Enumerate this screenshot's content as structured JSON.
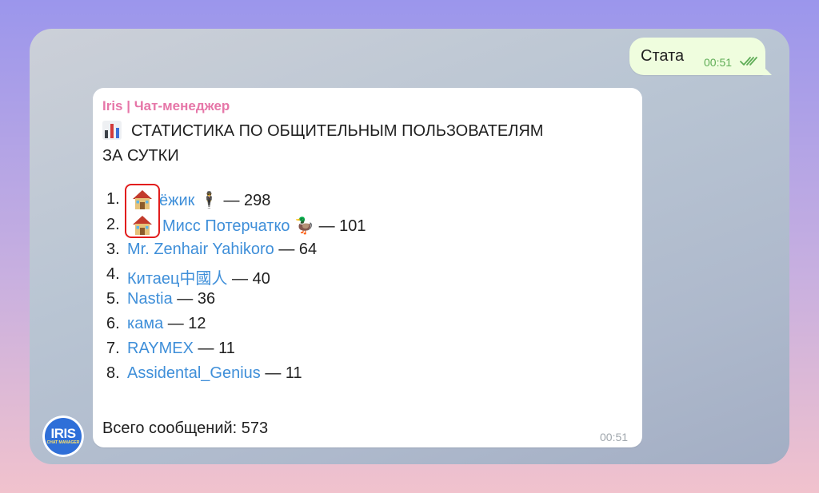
{
  "outgoing": {
    "text": "Стата",
    "time": "00:51",
    "status_icon": "double-check-icon"
  },
  "incoming": {
    "sender": "Iris | Чат-менеджер",
    "title_icon": "bar-chart-icon",
    "title_line1": "СТАТИСТИКА ПО ОБЩИТЕЛЬНЫМ ПОЛЬЗОВАТЕЛЯМ",
    "title_line2": "ЗА СУТКИ",
    "ranking": [
      {
        "rank": "1.",
        "name": "ёжик",
        "suffix": "🕴",
        "count": "— 298",
        "house": true
      },
      {
        "rank": "2.",
        "name": "Мисс Потерчатко",
        "suffix": "🦆",
        "count": "— 101",
        "house": true
      },
      {
        "rank": "3.",
        "name": "Mr. Zenhair Yahikoro",
        "suffix": "",
        "count": "— 64",
        "house": false
      },
      {
        "rank": "4.",
        "name": "Китаец中國人",
        "suffix": "",
        "count": "— 40",
        "house": false
      },
      {
        "rank": "5.",
        "name": "Nastia",
        "suffix": "",
        "count": "— 36",
        "house": false
      },
      {
        "rank": "6.",
        "name": "кама",
        "suffix": "",
        "count": "— 12",
        "house": false
      },
      {
        "rank": "7.",
        "name": "RAYMEX",
        "suffix": "",
        "count": "— 11",
        "house": false
      },
      {
        "rank": "8.",
        "name": "Assidental_Genius",
        "suffix": "",
        "count": "— 11",
        "house": false
      }
    ],
    "total": "Всего сообщений: 573",
    "time": "00:51"
  },
  "avatar": {
    "label": "IRIS",
    "sublabel": "CHAT MANAGER"
  },
  "colors": {
    "sender": "#e676a8",
    "link": "#3f8fd9",
    "outgoing_bubble": "#effdde",
    "highlight": "#e21d1d"
  }
}
